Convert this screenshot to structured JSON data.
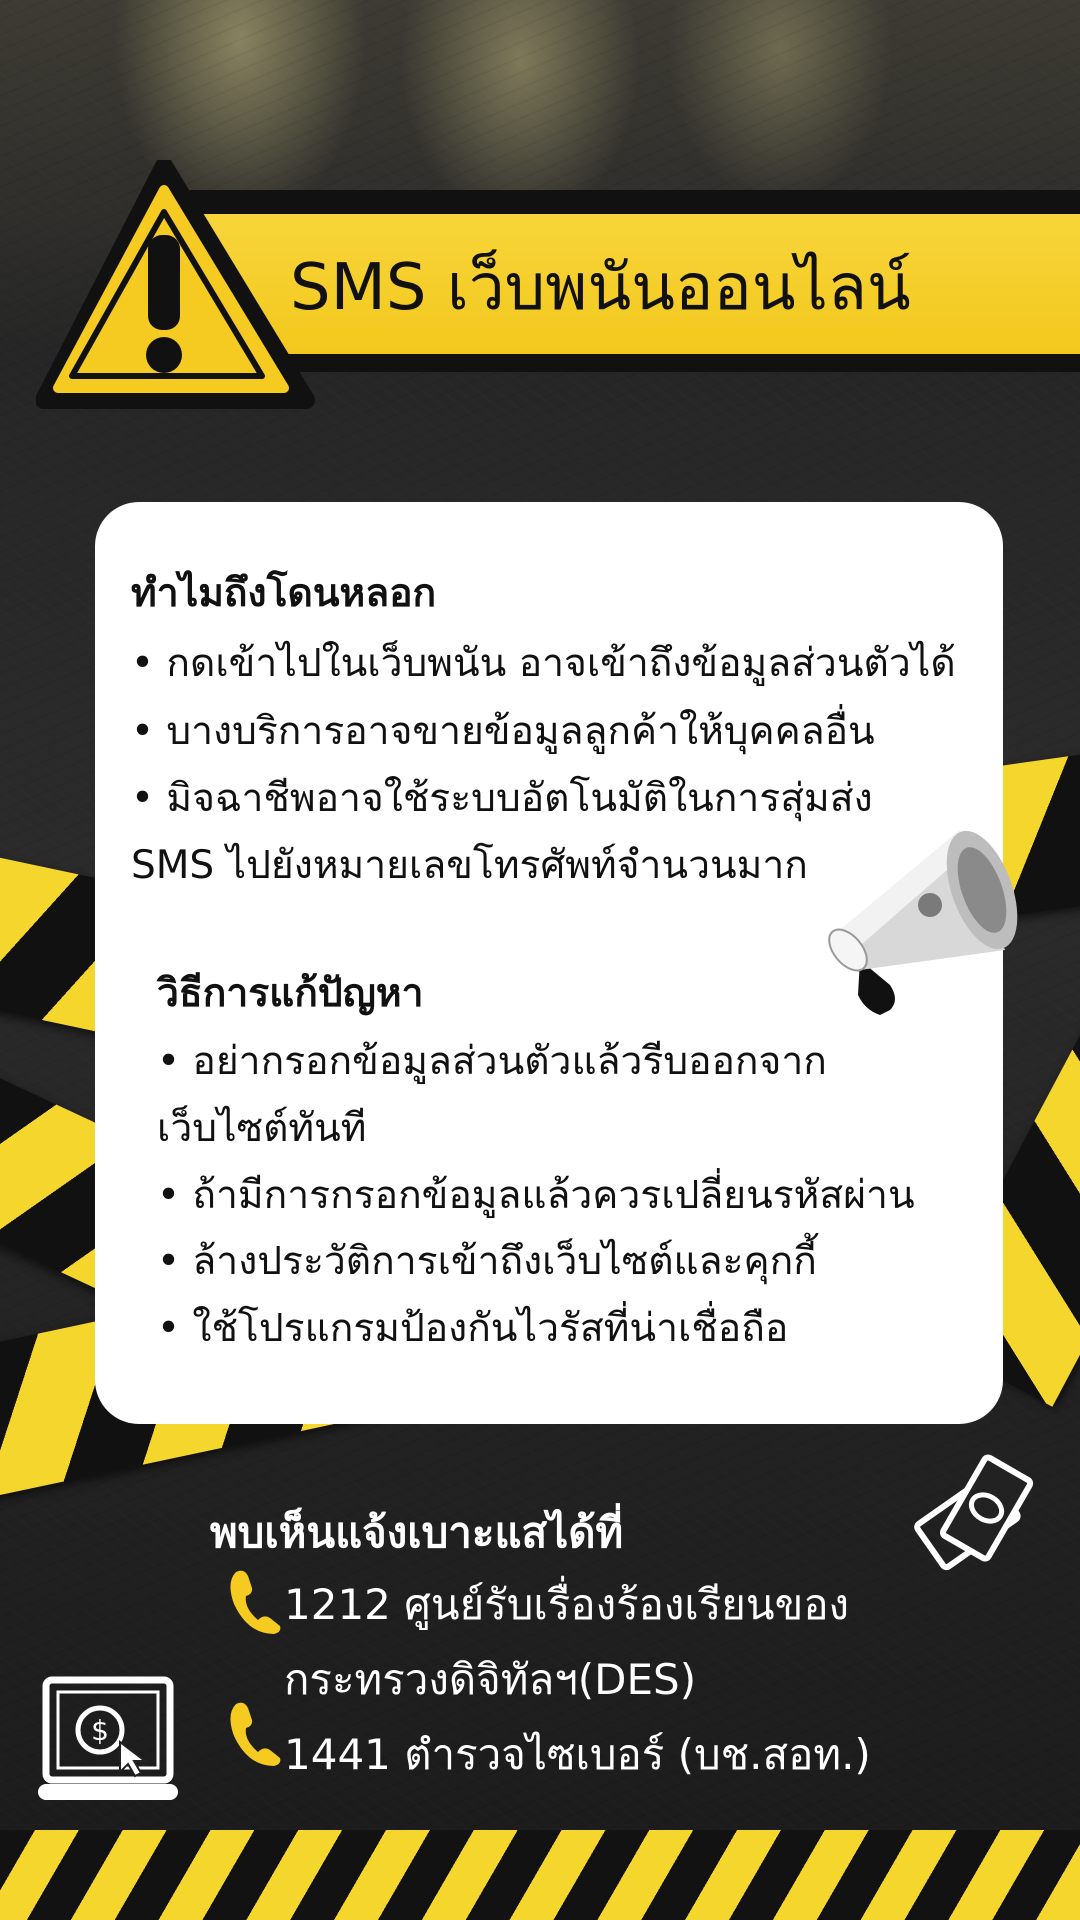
{
  "banner": {
    "title": "SMS เว็บพนันออนไลน์"
  },
  "card": {
    "why": {
      "heading": "ทำไมถึงโดนหลอก",
      "lines": [
        "• กดเข้าไปในเว็บพนัน อาจเข้าถึงข้อมูลส่วนตัวได้",
        "• บางบริการอาจขายข้อมูลลูกค้าให้บุคคลอื่น",
        "• มิจฉาชีพอาจใช้ระบบอัตโนมัติในการสุ่มส่ง",
        "SMS ไปยังหมายเลขโทรศัพท์จำนวนมาก"
      ]
    },
    "fix": {
      "heading": "วิธีการแก้ปัญหา",
      "lines": [
        "• อย่ากรอกข้อมูลส่วนตัวแล้วรีบออกจาก",
        "เว็บไซต์ทันที",
        "• ถ้ามีการกรอกข้อมูลแล้วควรเปลี่ยนรหัสผ่าน",
        "• ล้างประวัติการเข้าถึงเว็บไซต์และคุกกี้",
        "• ใช้โปรแกรมป้องกันไวรัสที่น่าเชื่อถือ"
      ]
    }
  },
  "report": {
    "title": "พบเห็นแจ้งเบาะแสได้ที่",
    "contacts": [
      {
        "line1": "1212 ศูนย์รับเรื่องร้องเรียนของ",
        "line2": "กระทรวงดิจิทัลฯ(DES)"
      },
      {
        "line1": "1441 ตำรวจไซเบอร์ (บช.สอท.)"
      }
    ]
  },
  "icons": [
    "warning-sign-icon",
    "megaphone-icon",
    "phone-icon",
    "money-icon",
    "laptop-dollar-icon"
  ],
  "colors": {
    "accent": "#f5d62c",
    "dark": "#111111",
    "card": "#ffffff"
  }
}
